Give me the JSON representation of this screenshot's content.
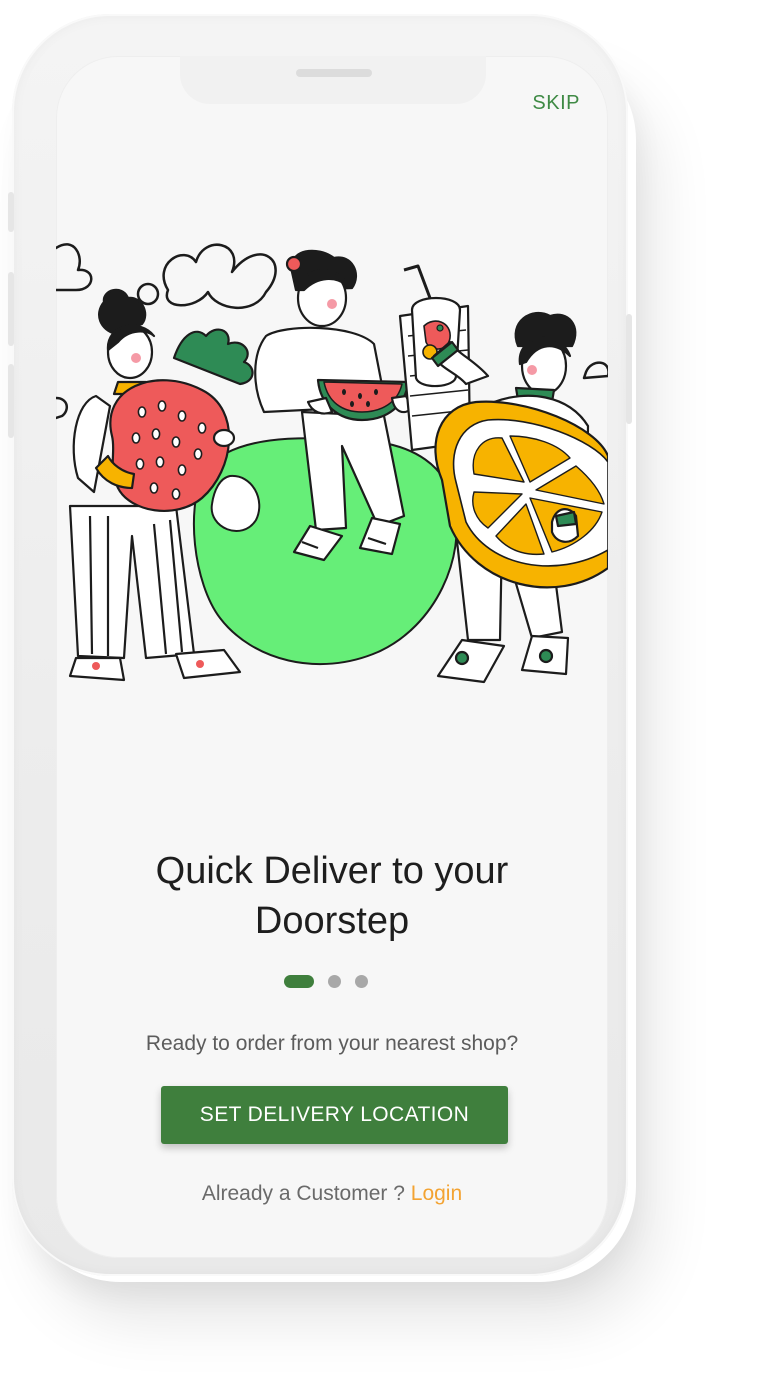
{
  "header": {
    "skip_label": "SKIP"
  },
  "onboarding": {
    "title_line1": "Quick Deliver to your",
    "title_line2": "Doorstep",
    "subtitle": "Ready to order from your nearest shop?",
    "cta_label": "SET DELIVERY LOCATION",
    "login_prompt": "Already a Customer ?",
    "login_label": "Login",
    "pager": {
      "total": 3,
      "active_index": 0
    }
  },
  "illustration": {
    "name": "people-with-giant-fruits-illustration"
  },
  "colors": {
    "accent_green": "#3f7f3d",
    "login_orange": "#f3a332",
    "screen_background": "#f7f7f7",
    "blob_green": "#66ee78",
    "strawberry_red": "#ee5a5a",
    "orange_yellow": "#f7b300"
  }
}
